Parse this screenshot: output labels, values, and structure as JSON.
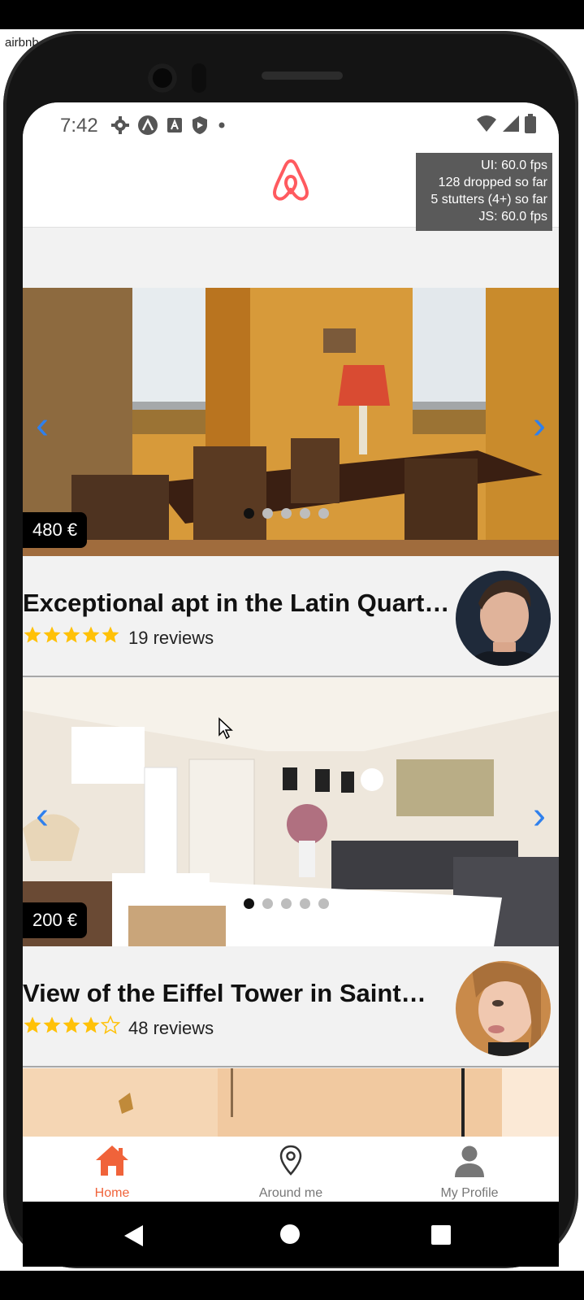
{
  "window": {
    "title": "airbnb"
  },
  "statusbar": {
    "time": "7:42"
  },
  "perf_overlay": {
    "ui_fps": "UI: 60.0 fps",
    "dropped": "128 dropped so far",
    "stutters": "5 stutters (4+) so far",
    "js_fps": "JS: 60.0 fps"
  },
  "listings": [
    {
      "price": "480 €",
      "title": "Exceptional apt in the Latin Quart…",
      "rating": 5,
      "reviews": "19 reviews",
      "photo_index": 1,
      "photo_count": 5
    },
    {
      "price": "200 €",
      "title": "View of the Eiffel Tower in Saint…",
      "rating": 4,
      "reviews": "48 reviews",
      "photo_index": 1,
      "photo_count": 5
    }
  ],
  "tabs": [
    {
      "label": "Home",
      "icon": "home-icon",
      "active": true
    },
    {
      "label": "Around me",
      "icon": "map-pin-icon",
      "active": false
    },
    {
      "label": "My Profile",
      "icon": "user-icon",
      "active": false
    }
  ],
  "colors": {
    "brand": "#FF5A5F",
    "accent": "#F0633A",
    "arrow": "#2F80ED",
    "star": "#FFC107"
  },
  "icons": [
    "settings-icon",
    "android-icon",
    "a-icon",
    "shield-icon",
    "wifi-icon",
    "signal-icon",
    "battery-icon",
    "chevron-left-icon",
    "chevron-right-icon",
    "star-icon"
  ]
}
